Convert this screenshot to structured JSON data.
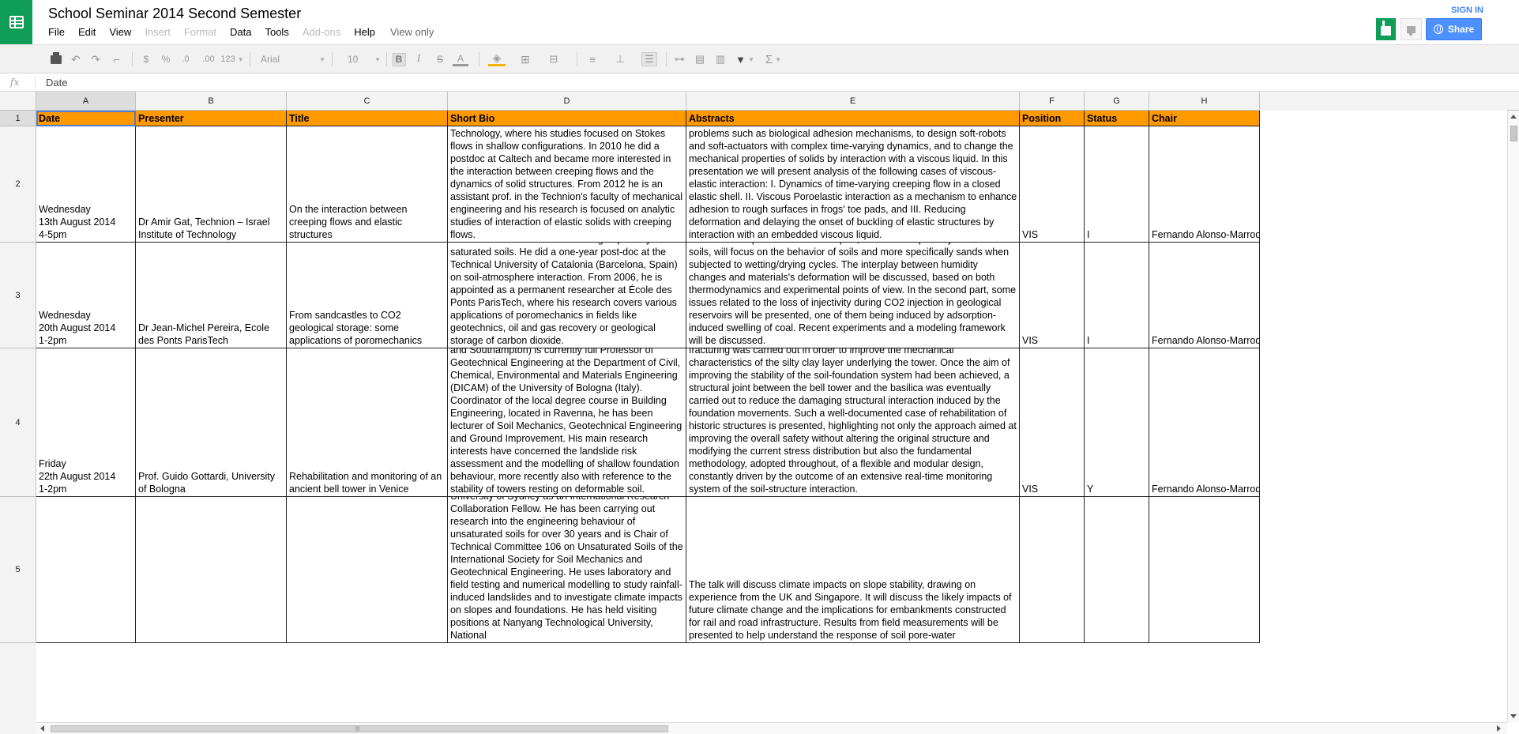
{
  "app": {
    "title": "School Seminar 2014 Second Semester"
  },
  "header": {
    "menus": [
      {
        "label": "File",
        "enabled": true
      },
      {
        "label": "Edit",
        "enabled": true
      },
      {
        "label": "View",
        "enabled": true
      },
      {
        "label": "Insert",
        "enabled": false
      },
      {
        "label": "Format",
        "enabled": false
      },
      {
        "label": "Data",
        "enabled": true
      },
      {
        "label": "Tools",
        "enabled": true
      },
      {
        "label": "Add-ons",
        "enabled": false
      },
      {
        "label": "Help",
        "enabled": true
      }
    ],
    "view_only_label": "View only",
    "sign_in_label": "SIGN IN",
    "share_label": "Share",
    "accent_color": "#0f9d58",
    "share_color": "#4d90fe"
  },
  "toolbar": {
    "currency_label": "$",
    "percent_label": "%",
    "decrease_decimals_label": ".0",
    "increase_decimals_label": ".00",
    "more_formats_label": "123",
    "font_family_label": "Arial",
    "font_size_label": "10",
    "bold_label": "B",
    "italic_label": "I",
    "strikethrough_label": "S",
    "text_color_label": "A",
    "functions_label": "Σ"
  },
  "formula_bar": {
    "fx_label": "fx",
    "value": "Date"
  },
  "grid": {
    "header_fill": "#ff9900",
    "columns": [
      "A",
      "B",
      "C",
      "D",
      "E",
      "F",
      "G",
      "H"
    ],
    "selected_column": "A",
    "rows": [
      "1",
      "2",
      "3",
      "4",
      "5"
    ],
    "selected_row": "1",
    "data": [
      [
        "Date",
        "Presenter",
        "Title",
        "Short Bio",
        "Abstracts",
        "Position",
        "Status",
        "Chair"
      ],
      [
        "Wednesday\n13th August 2014\n4-5pm",
        "Dr Amir Gat, Technion – Israel Institute of Technology",
        "On the interaction between creeping flows and elastic structures",
        "Amir Gat did his B.Sc. and Ph.D. in the Faculty of Aerospace engineering, Technion – Israel institute of Technology, where his studies focused on Stokes flows in shallow configurations. In 2010 he did a postdoc at Caltech and became more interested in the interaction between creeping flows and the dynamics of solid structures. From 2012 he is an assistant prof. in the Technion's faculty of mechanical engineering and his research is focused on analytic studies of interaction of elastic solids with creeping flows.",
        "Viscous flows in contact with elastic structures apply both pressure and shear stress at the solid-liquid interface and thus create internal stress- and deformation-fields within the solid structure. The goal of our research is to model such viscous-elastic interactions in order to understand problems such as biological adhesion mechanisms, to design soft-robots and soft-actuators with complex time-varying dynamics, and to change the mechanical properties of solids by interaction with a viscous liquid. In this presentation we will present analysis of the following cases of viscous-elastic interaction: I. Dynamics of time-varying creeping flow in a closed elastic shell. II. Viscous Poroelastic interaction as a mechanism to enhance adhesion to rough surfaces in frogs' toe pads, and III. Reducing deformation and delaying the onset of buckling of elastic structures by interaction with an embedded viscous liquid.",
        "VIS",
        "I",
        "Fernando Alonso-Marroquin"
      ],
      [
        "Wednesday\n20th August 2014\n1-2pm",
        "Dr Jean-Michel Pereira, Ecole des Ponts ParisTech",
        "From sandcastles to CO2 geological storage: some applications of poromechanics",
        "Jean-Michel Pereira graduated from ENTPE -École Nationale des Travaux Publics de l'État, Lyon, France-, where he completed his PhD in 2005 on theoretical and numerical modeling of partially saturated soils. He did a one-year post-doc at the Technical University of Catalonia (Barcelona, Spain) on soil-atmosphere interaction. From 2006, he is appointed as a permanent researcher at École des Ponts ParisTech, where his research covers various applications of poromechanics in fields like geotechnics, oil and gas recovery or geological storage of carbon dioxide.",
        "In this talk, a few applications of poromechanics -mechanics of porous media- will be presented. The first part, dedicated to partially saturated soils, will focus on the behavior of soils and more specifically sands when subjected to wetting/drying cycles. The interplay between humidity changes and materials's deformation will be discussed, based on both thermodynamics and experimental points of view. In the second part, some issues related to the loss of injectivity during CO2 injection in geological reservoirs will be presented, one of them being induced by adsorption-induced swelling of coal. Recent experiments and a modeling framework will be discussed.",
        "VIS",
        "I",
        "Fernando Alonso-Marroquin"
      ],
      [
        "Friday\n22th August 2014\n1-2pm",
        "Prof. Guido Gottardi, University of Bologna",
        "Rehabilitation and monitoring of an ancient bell tower in Venice",
        "Guido Gottardi (PhD in Geotechnical Engineering at the Technical University of Torino, Marie Curie Research Fellow at the British Universities of Oxford and Southampton) is currently full Professor of Geotechnical Engineering at the Department of Civil, Chemical, Environmental and Materials Engineering (DICAM) of the University of Bologna (Italy). Coordinator of the local degree course in Building Engineering, located in Ravenna, he has been lecturer of Soil Mechanics, Geotechnical Engineering and Ground Improvement. His main research interests have concerned the landslide risk assessment and the modelling of shallow foundation behaviour, more recently also with reference to the stability of towers resting on deformable soil.",
        "The Frari bell tower, the second tallest in Venice after San Marco, has always been affected by structural problems since its construction in XIV century, mainly because of the slow but continuous differential settlement between the tower itself and the adjacent masonry structures of the basilica. In the last decade, a rather innovative intervention of soil fracturing was carried out in order to improve the mechanical characteristics of the silty clay layer underlying the tower. Once the aim of improving the stability of the soil-foundation system had been achieved, a structural joint between the bell tower and the basilica was eventually carried out to reduce the damaging structural interaction induced by the foundation movements. Such a well-documented case of rehabilitation of historic structures is presented, highlighting not only the approach aimed at improving the overall safety without altering the original structure and modifying the current stress distribution but also the fundamental methodology, adopted throughout, of a flexible and modular design, constantly driven by the outcome of an extensive real-time monitoring system of the soil-structure interaction.",
        "VIS",
        "Y",
        "Fernando Alonso-Marroquin"
      ],
      [
        "",
        "",
        "",
        "Professor David Toll is Professor of Engineering at Durham University, UK. He is currently visiting University of Sydney as an International Research Collaboration Fellow. He has been carrying out research into the engineering behaviour of unsaturated soils for over 30 years and is Chair of Technical Committee 106 on Unsaturated Soils of the International Society for Soil Mechanics and Geotechnical Engineering. He uses laboratory and field testing and numerical modelling to study rainfall-induced landslides and to investigate climate impacts on slopes and foundations. He has held visiting positions at Nanyang Technological University, National",
        "The talk will discuss climate impacts on slope stability, drawing on experience from the UK and Singapore. It will discuss the likely impacts of future climate change and the implications for embankments constructed for rail and road infrastructure. Results from field measurements will be presented to help understand the response of soil pore-water",
        "",
        "",
        ""
      ]
    ]
  }
}
